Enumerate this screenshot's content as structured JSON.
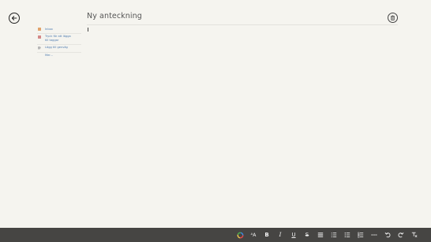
{
  "header": {
    "title": "Ny anteckning"
  },
  "sidebar": {
    "items": [
      {
        "label": "Inbox",
        "icon": "folder-icon"
      },
      {
        "label": "Tryck för att lägga till taggar",
        "icon": "page-icon"
      },
      {
        "label": "Lägg till genväg",
        "icon": "tag-icon"
      },
      {
        "label": "Mer..."
      }
    ]
  },
  "toolbar": {
    "buttons": [
      {
        "name": "color-icon"
      },
      {
        "name": "font-size-icon",
        "label": "ᴬA"
      },
      {
        "name": "bold-icon",
        "label": "B"
      },
      {
        "name": "italic-icon",
        "label": "I"
      },
      {
        "name": "underline-icon",
        "label": "U"
      },
      {
        "name": "strikethrough-icon",
        "label": "S"
      },
      {
        "name": "align-icon"
      },
      {
        "name": "numbered-list-icon"
      },
      {
        "name": "bullet-list-icon"
      },
      {
        "name": "checkbox-list-icon"
      },
      {
        "name": "horizontal-rule-icon"
      },
      {
        "name": "undo-icon"
      },
      {
        "name": "redo-icon"
      },
      {
        "name": "clear-formatting-icon"
      }
    ]
  },
  "colors": {
    "background": "#f5f4ef",
    "toolbar": "#464543",
    "link": "#4f7cb0"
  }
}
